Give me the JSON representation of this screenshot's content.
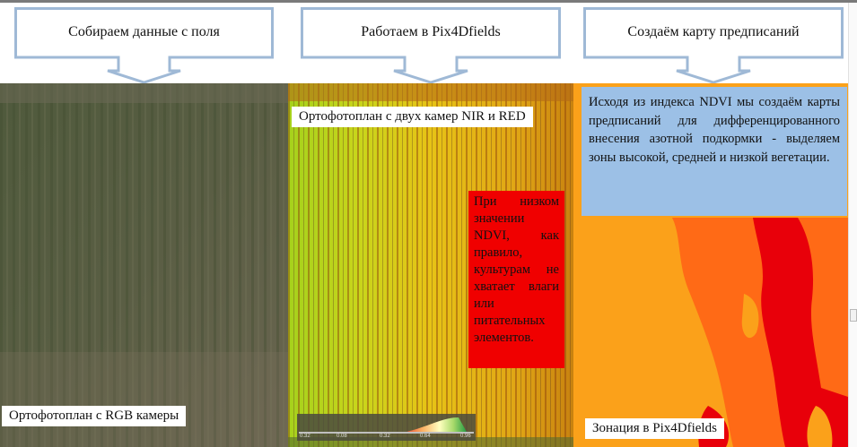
{
  "callouts": [
    {
      "text": "Собираем данные с поля"
    },
    {
      "text": "Работаем в Pix4Dfields"
    },
    {
      "text": "Создаём карту предписаний"
    }
  ],
  "panels": {
    "rgb": {
      "label": "Ортофотоплан с RGB камеры"
    },
    "ndvi": {
      "label": "Ортофотоплан с двух камер NIR и RED",
      "note": "При низком значении NDVI, как правило, культурам не хватает влаги или питательных элементов.",
      "legend": {
        "ticks": [
          "0.32",
          "0.08",
          "0.32",
          "0.64",
          "0.96"
        ]
      }
    },
    "zones": {
      "label": "Зонация в Pix4Dfields",
      "note": "Исходя из индекса NDVI мы создаём карты предписаний для дифференцированного внесения азотной подкормки - выделяем зоны высокой, средней и низкой вегетации."
    }
  },
  "colors": {
    "callout_border": "#9fb9d6",
    "red_note": "#f00000",
    "blue_note": "#9cc0e6",
    "zone_low": "#e8000a",
    "zone_mid": "#ff6a16",
    "zone_high": "#fba11a"
  }
}
